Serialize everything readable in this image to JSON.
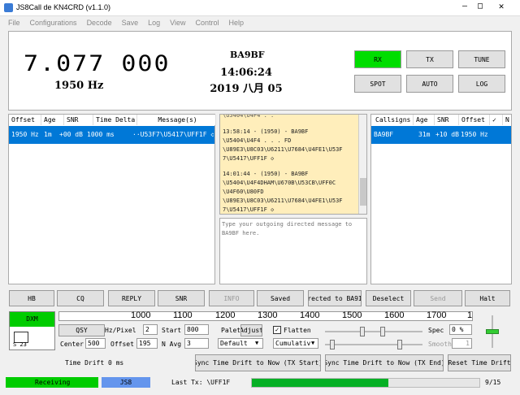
{
  "window": {
    "title": "JS8Call de KN4CRD (v1.1.0)",
    "icon": "js8-logo-icon"
  },
  "menu": [
    "File",
    "Configurations",
    "Decode",
    "Save",
    "Log",
    "View",
    "Control",
    "Help"
  ],
  "header": {
    "frequency": "7.077 000",
    "offset": "1950 Hz",
    "callsign": "BA9BF",
    "time": "14:06:24",
    "date": "2019 八月 05",
    "buttons": {
      "rx": "RX",
      "tx": "TX",
      "tune": "TUNE",
      "spot": "SPOT",
      "auto": "AUTO",
      "log": "LOG"
    }
  },
  "band_activity": {
    "headers": [
      "Offset",
      "Age",
      "SNR",
      "Time Delta",
      "Message(s)"
    ],
    "rows": [
      {
        "offset": "1950 Hz",
        "age": "1m",
        "snr": "+00 dB",
        "delta": "1000 ms",
        "message": "··U53F7\\U5417\\UFF1F ◇"
      }
    ]
  },
  "messages": {
    "top_partial": "\\U5404\\U4F4 . .",
    "block1_header": "13:58:14 - (1950) - BA9BF",
    "block1_lines": [
      "\\U5404\\U4F4 . . . FD",
      "\\U89E3\\U8C03\\U6211\\U7684\\U4FE1\\U53F",
      "7\\U5417\\UFF1F ◇"
    ],
    "block2_header": "14:01:44 - (1950) - BA9BF",
    "block2_lines": [
      "\\U5404\\U4F4DHAM\\U670B\\U53CB\\UFF0C",
      "\\U4F60\\U80FD",
      "\\U89E3\\U8C03\\U6211\\U7684\\U4FE1\\U53F",
      "7\\U5417\\UFF1F ◇"
    ],
    "compose_placeholder": "Type your outgoing directed message to BA9BF here."
  },
  "call_activity": {
    "headers": [
      "Callsigns",
      "Age",
      "SNR",
      "Offset",
      "✓",
      "N"
    ],
    "rows": [
      {
        "callsign": "BA9BF",
        "age": "31m",
        "snr": "+10 dB",
        "offset": "1950 Hz"
      }
    ]
  },
  "action_buttons": [
    "HB",
    "CQ",
    "REPLY",
    "SNR",
    "INFO",
    "Saved",
    "rected to BA9I",
    "Deselect",
    "Send",
    "Halt"
  ],
  "waterfall": {
    "ticks": [
      "1000",
      "1100",
      "1200",
      "1300",
      "1400",
      "1500",
      "1600",
      "1700",
      "1"
    ]
  },
  "controls": {
    "mode_label": "DXM",
    "qsy": "QSY",
    "hz_pixel_label": "Hz/Pixel",
    "hz_pixel_value": "2",
    "start_label": "Start",
    "start_value": "800",
    "center_label": "Center",
    "center_value": "500",
    "offset_label": "Offset",
    "offset_value": "195",
    "navg_label": "N Avg",
    "navg_value": "3",
    "palette_label": "Palette",
    "adjust": "Adjust",
    "default_select": "Default",
    "flatten_label": "Flatten",
    "cumulative_select": "Cumulativ",
    "spec_label": "Spec",
    "spec_value": "0 %",
    "smooth_label": "Smooth",
    "smooth_value": "1",
    "s_meter": "S 23"
  },
  "time_drift": {
    "label": "Time Drift 0 ms",
    "sync_start": "Sync Time Drift to Now (TX Start)",
    "sync_end": "Sync Time Drift to Now (TX End)",
    "reset": "Reset Time Drift"
  },
  "status": {
    "receiving": "Receiving",
    "mode": "JS8",
    "last_tx": "Last Tx: \\UFF1F",
    "progress_text": "9/15",
    "progress_fraction": 0.6
  },
  "colors": {
    "green": "#00cc00",
    "blue": "#6495ed",
    "yellow_panel": "#ffeebb",
    "selection": "#0078d7"
  }
}
